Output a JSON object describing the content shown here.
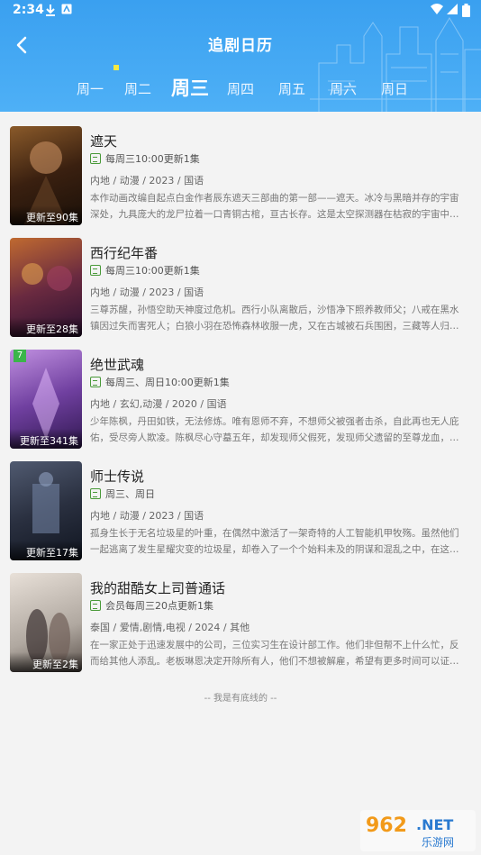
{
  "status_bar": {
    "time": "2:34"
  },
  "header": {
    "title": "追剧日历",
    "tabs": [
      "周一",
      "周二",
      "周三",
      "周四",
      "周五",
      "周六",
      "周日"
    ],
    "active_tab": "周三"
  },
  "shows": [
    {
      "title": "遮天",
      "poster_text": "更新至90集",
      "schedule": "每周三10:00更新1集",
      "meta": "内地 / 动漫 / 2023 / 国语",
      "desc": "本作动画改编自起点白金作者辰东遮天三部曲的第一部——遮天。冰冷与黑暗并存的宇宙深处，九具庞大的龙尸拉着一口青铜古棺，亘古长存。这是太空探测器在枯寂的宇宙中…"
    },
    {
      "title": "西行纪年番",
      "poster_text": "更新至28集",
      "schedule": "每周三10:00更新1集",
      "meta": "内地 / 动漫 / 2023 / 国语",
      "desc": "三尊苏醒，孙悟空助天神度过危机。西行小队离散后，沙悟净下照养教师父；八戒在黑水镇因过失而害死人；白狼小羽在恐怖森林收服一虎，又在古城被石兵围困，三藏等人归…"
    },
    {
      "title": "绝世武魂",
      "poster_text": "更新至341集",
      "corner": "7",
      "schedule": "每周三、周日10:00更新1集",
      "meta": "内地 / 玄幻,动漫 / 2020 / 国语",
      "desc": "少年陈枫，丹田如铁，无法修炼。唯有恩师不弃，不想师父被强者击杀，自此再也无人庇佑，受尽旁人欺凌。陈枫尽心守墓五年，却发现师父假死，发现师父遗留的至尊龙血，…"
    },
    {
      "title": "师士传说",
      "poster_text": "更新至17集",
      "schedule": "周三、周日",
      "meta": "内地 / 动漫 / 2023 / 国语",
      "desc": "孤身生长于无名垃圾星的叶重，在偶然中激活了一架奇特的人工智能机甲牧殇。虽然他们一起逃离了发生星耀灾变的垃圾星，却卷入了一个个始料未及的阴谋和混乱之中，在这…"
    },
    {
      "title": "我的甜酷女上司普通话",
      "poster_text": "更新至2集",
      "schedule": "会员每周三20点更新1集",
      "meta": "泰国 / 爱情,剧情,电视 / 2024 / 其他",
      "desc": "在一家正处于迅速发展中的公司，三位实习生在设计部工作。他们非但帮不上什么忙，反而给其他人添乱。老板琳恩决定开除所有人，他们不想被解雇，希望有更多时间可以证…"
    }
  ],
  "footer": "-- 我是有底线的 --",
  "watermark": "962.NET 乐游网",
  "colors": {
    "header": "#3aa0f0",
    "schedule_icon": "#4a9a3a"
  }
}
